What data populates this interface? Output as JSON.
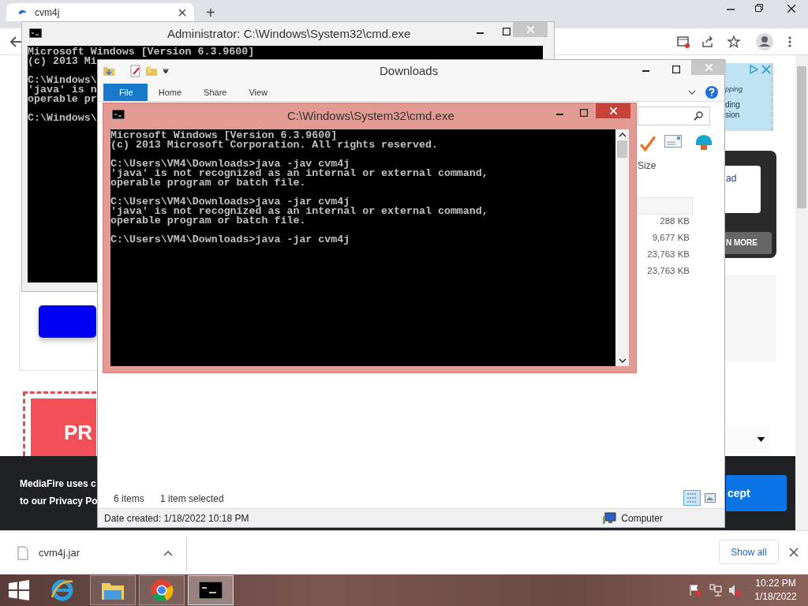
{
  "browser": {
    "tab": {
      "title": "cvm4j"
    },
    "new_tab": "+",
    "page": {
      "ad_lines": [
        "pping",
        "ding",
        "sion"
      ],
      "card": {
        "link": "ad",
        "button": "N MORE"
      },
      "promo": "PR",
      "cookie_banner": {
        "lines": [
          "MediaFire uses c",
          "to our Privacy Po"
        ],
        "accept": "cept"
      }
    },
    "download_bar": {
      "file": "cvm4j.jar",
      "show_all": "Show all"
    }
  },
  "back_console": {
    "title": "Administrator: C:\\Windows\\System32\\cmd.exe",
    "blocks": [
      [
        "Microsoft Windows [Version 6.3.9600]",
        "(c) 2013 Mi"
      ],
      [
        "C:\\Windows\\",
        "'java' is n",
        "operable pr"
      ],
      [
        "C:\\Windows\\"
      ]
    ]
  },
  "explorer": {
    "title": "Downloads",
    "ribbon_tabs": [
      {
        "label": "File",
        "selected": true
      },
      {
        "label": "Home",
        "selected": false
      },
      {
        "label": "Share",
        "selected": false
      },
      {
        "label": "View",
        "selected": false
      }
    ],
    "column": "Size",
    "sizes": [
      "288 KB",
      "9,677 KB",
      "23,763 KB",
      "23,763 KB"
    ],
    "status": {
      "count": "6 items",
      "selection": "1 item selected"
    },
    "details": {
      "date": "Date created: 1/18/2022 10:18 PM",
      "location": "Computer"
    }
  },
  "front_console": {
    "title": "C:\\Windows\\System32\\cmd.exe",
    "blocks": [
      [
        "Microsoft Windows [Version 6.3.9600]",
        "(c) 2013 Microsoft Corporation. All rights reserved."
      ],
      [
        "C:\\Users\\VM4\\Downloads>java -jav cvm4j",
        "'java' is not recognized as an internal or external command,",
        "operable program or batch file."
      ],
      [
        "C:\\Users\\VM4\\Downloads>java -jar cvm4j",
        "'java' is not recognized as an internal or external command,",
        "operable program or batch file."
      ],
      [
        "C:\\Users\\VM4\\Downloads>java -jar cvm4j"
      ]
    ]
  },
  "taskbar": {
    "time": "10:22 PM",
    "date": "1/18/2022"
  }
}
